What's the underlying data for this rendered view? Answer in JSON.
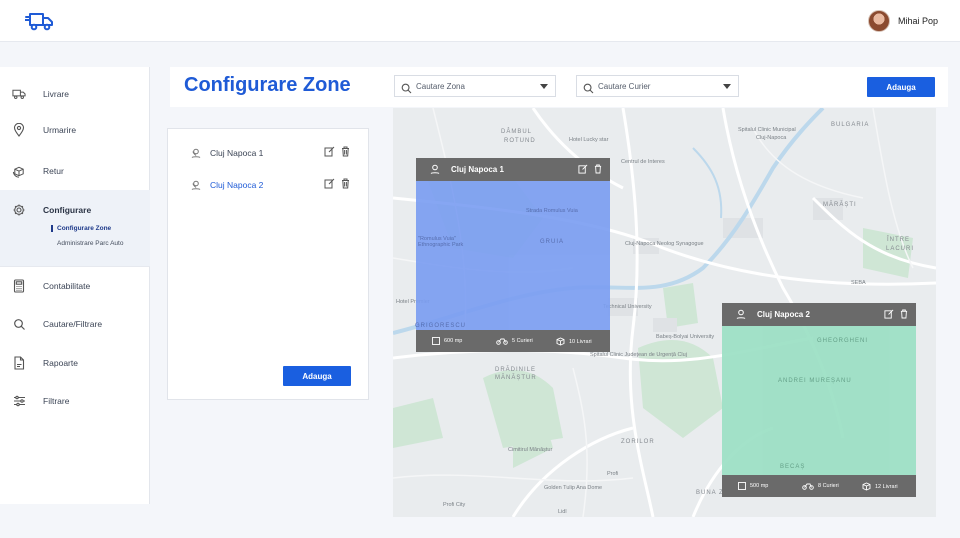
{
  "header": {
    "user_name": "Mihai Pop"
  },
  "sidebar": {
    "items": [
      {
        "label": "Livrare"
      },
      {
        "label": "Urmarire"
      },
      {
        "label": "Retur"
      },
      {
        "label": "Configurare",
        "sub": [
          {
            "label": "Configurare Zone"
          },
          {
            "label": "Administrare Parc Auto"
          }
        ]
      },
      {
        "label": "Contabilitate"
      },
      {
        "label": "Cautare/Filtrare"
      },
      {
        "label": "Rapoarte"
      },
      {
        "label": "Filtrare"
      }
    ]
  },
  "page": {
    "title": "Configurare Zone",
    "zone_search_placeholder": "Cautare Zona",
    "courier_search_placeholder": "Cautare Curier",
    "add_label": "Adauga"
  },
  "zones_panel": {
    "items": [
      {
        "name": "Cluj Napoca 1"
      },
      {
        "name": "Cluj Napoca 2"
      }
    ],
    "add_label": "Adauga"
  },
  "map": {
    "zones": [
      {
        "name": "Cluj Napoca 1",
        "area": "600 mp",
        "couriers": "5 Curieri",
        "deliveries": "10 Livrari",
        "color": "#7a9df2"
      },
      {
        "name": "Cluj Napoca 2",
        "area": "500 mp",
        "couriers": "8 Curieri",
        "deliveries": "12 Livrari",
        "color": "#9be0c4"
      }
    ],
    "labels": {
      "dambul": "DÂMBUL",
      "rotund": "ROTUND",
      "hotel_lucky": "Hotel Lucky star",
      "centrul": "Centrul de Interes",
      "spital_municipal": "Spitalul Clinic Municipal",
      "cluj_napoca": "Cluj-Napoca",
      "bulgaria": "BULGARIA",
      "marasti": "MĂRĂȘTI",
      "intre": "ÎNTRE",
      "lacuri": "LACURI",
      "romulus": "Strada Romulus Vuia",
      "ethno": "\"Romulus Vuia\" Ethnographic Park",
      "gruia": "GRUIA",
      "synagogue": "Cluj-Napoca Neolog Synagogue",
      "hotel_premier": "Hotel Premier",
      "grigorescu": "GRIGORESCU",
      "technical": "Technical University",
      "babes": "Babeș-Bolyai University",
      "spital_judetean": "Spitalul Clinic Județean de Urgență Cluj",
      "dradinile": "DRĂDINILE",
      "manastur": "MĂNĂȘTUR",
      "zorilor": "ZORILOR",
      "cimitirul": "Cimitirul Mănăștur",
      "golden": "Golden Tulip Ana Dome",
      "profi1": "Profi",
      "profi2": "Profi City",
      "lidl": "Lidl",
      "sebo": "SEBA",
      "gheorgheni": "GHEORGHENI",
      "andrei": "ANDREI MUREȘANU",
      "becas": "BECAȘ",
      "buna": "BUNA ZIUA"
    }
  }
}
